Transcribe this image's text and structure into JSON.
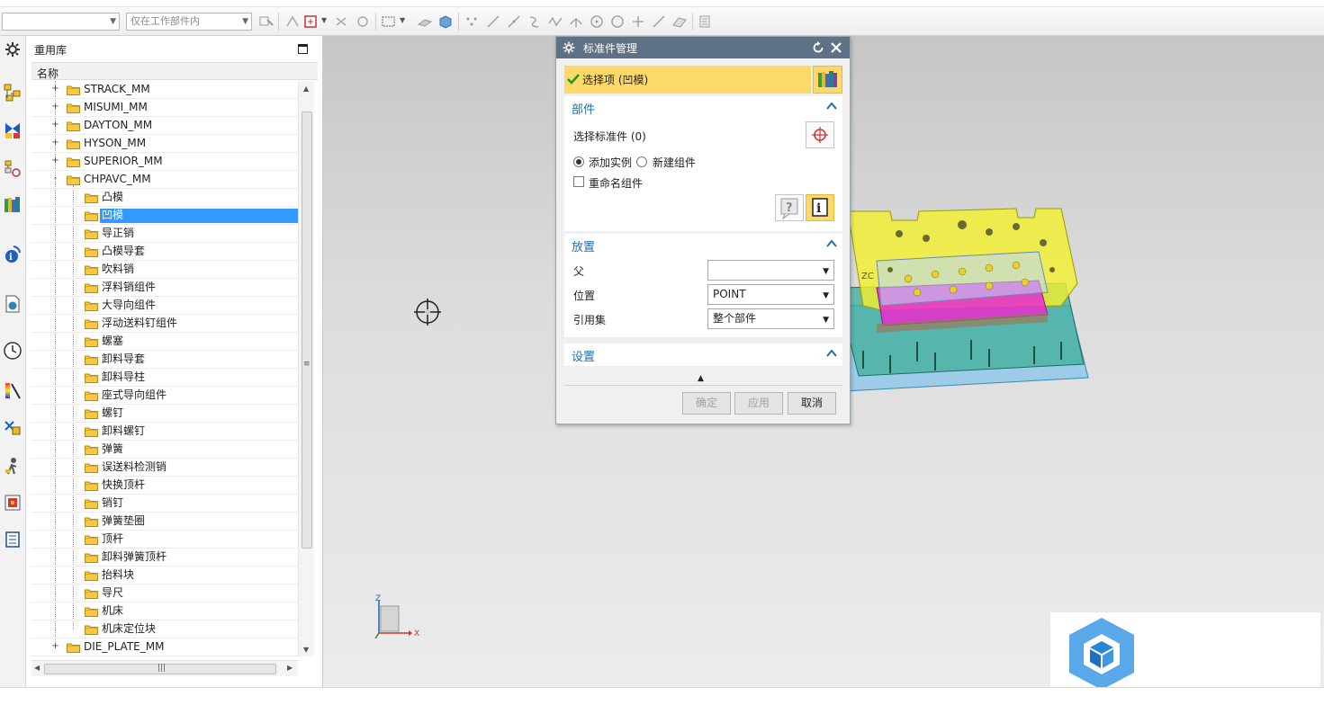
{
  "toolbar": {
    "filter_value": "",
    "scope_value": "仅在工作部件内"
  },
  "library": {
    "title": "重用库",
    "column_header": "名称",
    "items": [
      {
        "label": "STRACK_MM",
        "level": 0,
        "expander": "+"
      },
      {
        "label": "MISUMI_MM",
        "level": 0,
        "expander": "+"
      },
      {
        "label": "DAYTON_MM",
        "level": 0,
        "expander": "+"
      },
      {
        "label": "HYSON_MM",
        "level": 0,
        "expander": "+"
      },
      {
        "label": "SUPERIOR_MM",
        "level": 0,
        "expander": "+"
      },
      {
        "label": "CHPAVC_MM",
        "level": 0,
        "expander": "-"
      },
      {
        "label": "凸模",
        "level": 1
      },
      {
        "label": "凹模",
        "level": 1,
        "selected": true
      },
      {
        "label": "导正销",
        "level": 1
      },
      {
        "label": "凸模导套",
        "level": 1
      },
      {
        "label": "吹料销",
        "level": 1
      },
      {
        "label": "浮料销组件",
        "level": 1
      },
      {
        "label": "大导向组件",
        "level": 1
      },
      {
        "label": "浮动送料钉组件",
        "level": 1
      },
      {
        "label": "螺塞",
        "level": 1
      },
      {
        "label": "卸料导套",
        "level": 1
      },
      {
        "label": "卸料导柱",
        "level": 1
      },
      {
        "label": "座式导向组件",
        "level": 1
      },
      {
        "label": "螺钉",
        "level": 1
      },
      {
        "label": "卸料螺钉",
        "level": 1
      },
      {
        "label": "弹簧",
        "level": 1
      },
      {
        "label": "误送料检测销",
        "level": 1
      },
      {
        "label": "快换顶杆",
        "level": 1
      },
      {
        "label": "销钉",
        "level": 1
      },
      {
        "label": "弹簧垫圈",
        "level": 1
      },
      {
        "label": "顶杆",
        "level": 1
      },
      {
        "label": "卸料弹簧顶杆",
        "level": 1
      },
      {
        "label": "抬料块",
        "level": 1
      },
      {
        "label": "导尺",
        "level": 1
      },
      {
        "label": "机床",
        "level": 1
      },
      {
        "label": "机床定位块",
        "level": 1
      },
      {
        "label": "DIE_PLATE_MM",
        "level": 0,
        "expander": "+"
      }
    ]
  },
  "dialog": {
    "title": "标准件管理",
    "selection": "选择项 (凹模)",
    "part_group": {
      "title": "部件",
      "select_label": "选择标准件 (0)",
      "add_instance": "添加实例",
      "new_component": "新建组件",
      "rename_component": "重命名组件",
      "add_instance_selected": true,
      "rename_checked": false
    },
    "placement_group": {
      "title": "放置",
      "parent_label": "父",
      "parent_value": "",
      "position_label": "位置",
      "position_value": "POINT",
      "refset_label": "引用集",
      "refset_value": "整个部件"
    },
    "settings_group": {
      "title": "设置"
    },
    "buttons": {
      "ok": "确定",
      "apply": "应用",
      "cancel": "取消"
    }
  },
  "viewport": {
    "triad": {
      "z": "Z",
      "x": "X"
    },
    "model_label": "ZC"
  },
  "colors": {
    "title_bar": "#5e7186",
    "selection_highlight": "#3399ff",
    "section_header": "#1f6fb3",
    "selection_bar": "#fdd86a"
  }
}
